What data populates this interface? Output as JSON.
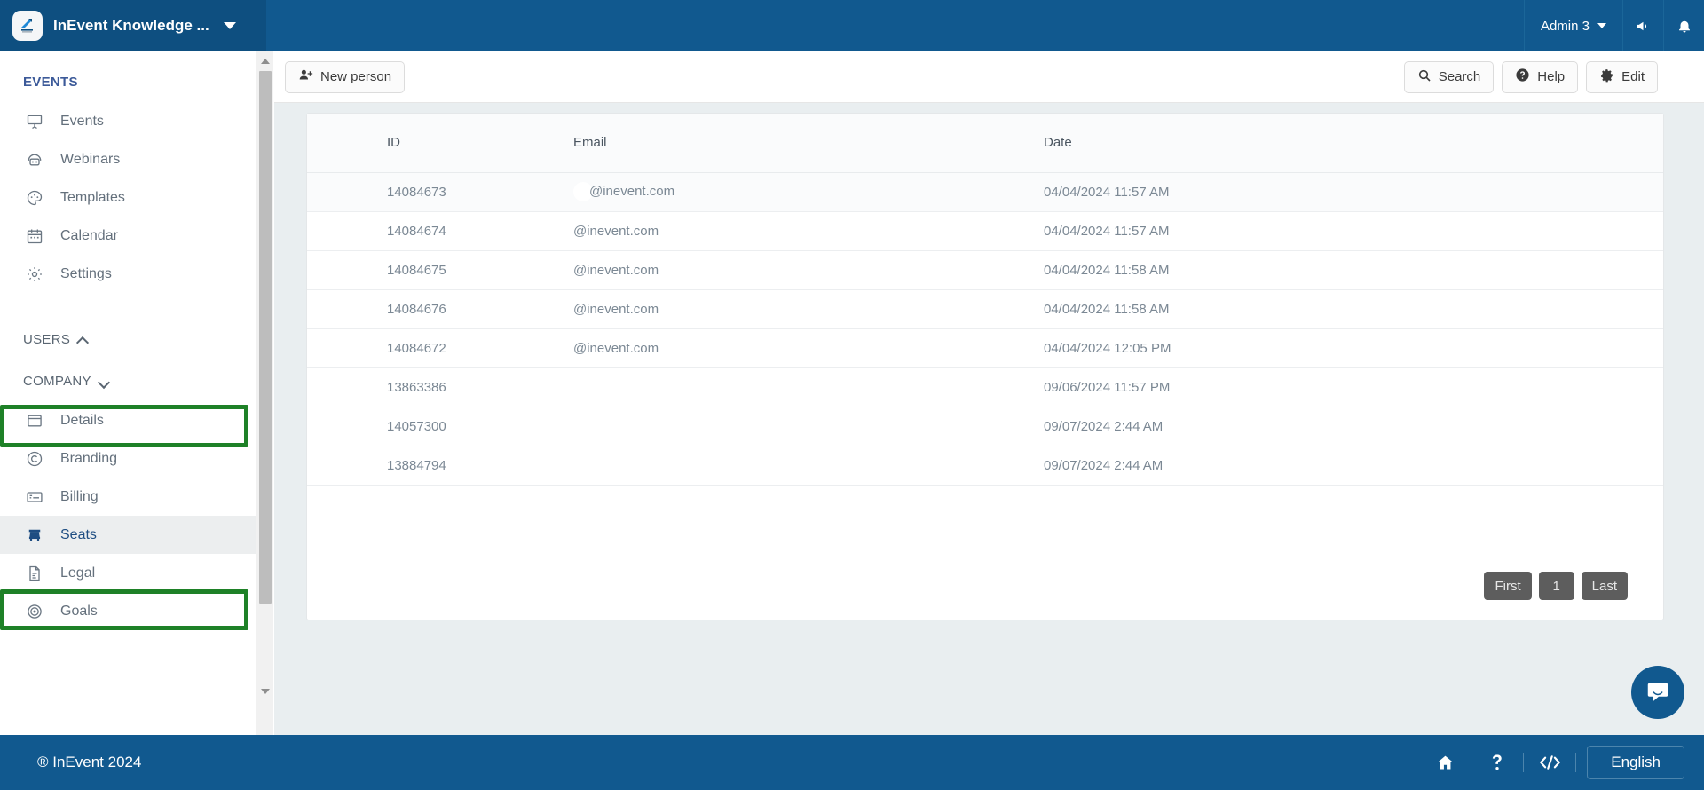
{
  "topbar": {
    "org_name": "InEvent Knowledge ...",
    "org_caret_icon": "chevron-down-icon",
    "logo_icon": "inevent-logo-icon",
    "user_label": "Admin 3",
    "user_caret_icon": "chevron-down-icon",
    "announce_icon": "megaphone-icon",
    "bell_icon": "bell-icon",
    "bg_color": "#11598f",
    "left_bg_color": "#0e4f80"
  },
  "sidebar": {
    "events_section_label": "EVENTS",
    "events_items": [
      {
        "label": "Events",
        "icon": "presentation-screen-icon"
      },
      {
        "label": "Webinars",
        "icon": "webinar-headset-icon"
      },
      {
        "label": "Templates",
        "icon": "palette-icon"
      },
      {
        "label": "Calendar",
        "icon": "calendar-icon"
      },
      {
        "label": "Settings",
        "icon": "gear-icon"
      }
    ],
    "users_group": {
      "label": "USERS",
      "chevron": "chevron-up-icon"
    },
    "company_group": {
      "label": "COMPANY",
      "chevron": "chevron-down-icon"
    },
    "company_items": [
      {
        "label": "Details",
        "icon": "window-icon",
        "active": false
      },
      {
        "label": "Branding",
        "icon": "copyright-icon",
        "active": false
      },
      {
        "label": "Billing",
        "icon": "credit-card-icon",
        "active": false
      },
      {
        "label": "Seats",
        "icon": "seat-chair-icon",
        "active": true
      },
      {
        "label": "Legal",
        "icon": "document-icon",
        "active": false
      },
      {
        "label": "Goals",
        "icon": "target-icon",
        "active": false
      }
    ],
    "scrollbar": {
      "up_arrow_icon": "scroll-up-arrow-icon",
      "down_arrow_icon": "scroll-down-arrow-icon"
    },
    "active_color": "#1e4d82"
  },
  "toolbar": {
    "new_person_label": "New person",
    "new_person_icon": "add-person-icon",
    "search_label": "Search",
    "search_icon": "search-icon",
    "help_label": "Help",
    "help_icon": "question-circle-icon",
    "edit_label": "Edit",
    "edit_icon": "gear-icon"
  },
  "table": {
    "columns": [
      "ID",
      "Email",
      "Date"
    ],
    "rows": [
      {
        "id": "14084673",
        "email": "@inevent.com",
        "date": "04/04/2024 11:57 AM",
        "redacted": true
      },
      {
        "id": "14084674",
        "email": "@inevent.com",
        "date": "04/04/2024 11:57 AM",
        "redacted": false
      },
      {
        "id": "14084675",
        "email": "@inevent.com",
        "date": "04/04/2024 11:58 AM",
        "redacted": false
      },
      {
        "id": "14084676",
        "email": "@inevent.com",
        "date": "04/04/2024 11:58 AM",
        "redacted": false
      },
      {
        "id": "14084672",
        "email": "@inevent.com",
        "date": "04/04/2024 12:05 PM",
        "redacted": false
      },
      {
        "id": "13863386",
        "email": "",
        "date": "09/06/2024 11:57 PM",
        "redacted": false
      },
      {
        "id": "14057300",
        "email": "",
        "date": "09/07/2024 2:44 AM",
        "redacted": false
      },
      {
        "id": "13884794",
        "email": "",
        "date": "09/07/2024 2:44 AM",
        "redacted": false
      }
    ]
  },
  "pagination": {
    "first_label": "First",
    "current_page": "1",
    "last_label": "Last"
  },
  "chat": {
    "icon": "chat-bubble-icon",
    "color": "#11598f"
  },
  "footer": {
    "copyright": "® InEvent 2024",
    "home_icon": "home-icon",
    "help_icon": "question-mark-icon",
    "code_icon": "code-brackets-icon",
    "language_label": "English",
    "bg_color": "#11598f"
  },
  "highlights": {
    "color": "#1e8127",
    "boxes": [
      {
        "name": "company-group-highlight",
        "target": "COMPANY"
      },
      {
        "name": "seats-item-highlight",
        "target": "Seats"
      }
    ]
  }
}
